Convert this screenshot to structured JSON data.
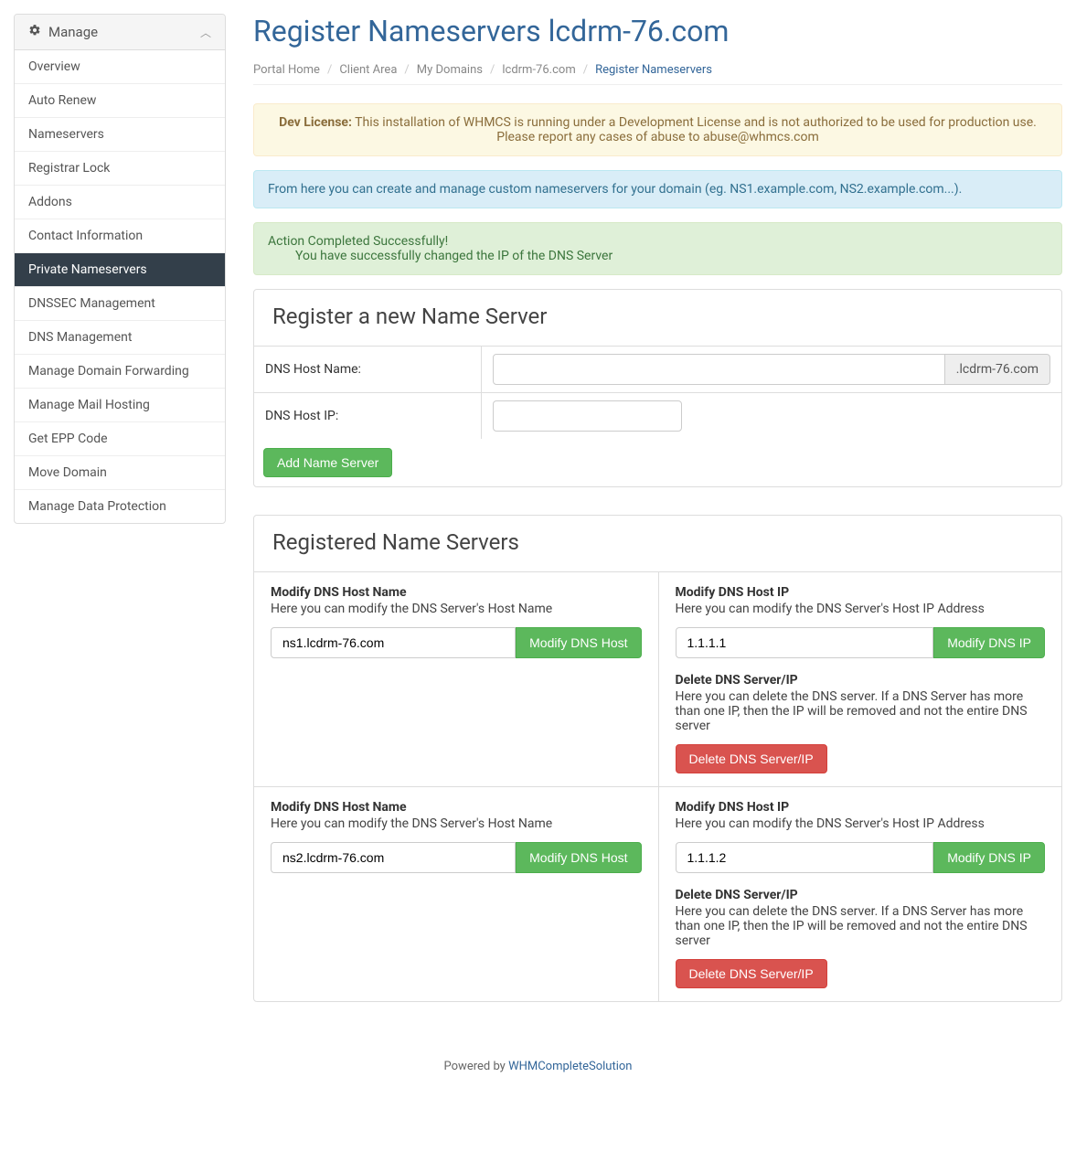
{
  "sidebar": {
    "header": "Manage",
    "items": [
      {
        "label": "Overview",
        "active": false
      },
      {
        "label": "Auto Renew",
        "active": false
      },
      {
        "label": "Nameservers",
        "active": false
      },
      {
        "label": "Registrar Lock",
        "active": false
      },
      {
        "label": "Addons",
        "active": false
      },
      {
        "label": "Contact Information",
        "active": false
      },
      {
        "label": "Private Nameservers",
        "active": true
      },
      {
        "label": "DNSSEC Management",
        "active": false
      },
      {
        "label": "DNS Management",
        "active": false
      },
      {
        "label": "Manage Domain Forwarding",
        "active": false
      },
      {
        "label": "Manage Mail Hosting",
        "active": false
      },
      {
        "label": "Get EPP Code",
        "active": false
      },
      {
        "label": "Move Domain",
        "active": false
      },
      {
        "label": "Manage Data Protection",
        "active": false
      }
    ]
  },
  "page_title": "Register Nameservers lcdrm-76.com",
  "breadcrumb": [
    {
      "label": "Portal Home"
    },
    {
      "label": "Client Area"
    },
    {
      "label": "My Domains"
    },
    {
      "label": "lcdrm-76.com"
    },
    {
      "label": "Register Nameservers",
      "active": true
    }
  ],
  "alerts": {
    "dev_prefix": "Dev License:",
    "dev_text": " This installation of WHMCS is running under a Development License and is not authorized to be used for production use. Please report any cases of abuse to abuse@whmcs.com",
    "info_text": "From here you can create and manage custom nameservers for your domain (eg. NS1.example.com, NS2.example.com...).",
    "success_title": "Action Completed Successfully!",
    "success_body": "You have successfully changed the IP of the DNS Server"
  },
  "register_panel": {
    "title": "Register a new Name Server",
    "hostname_label": "DNS Host Name:",
    "hostip_label": "DNS Host IP:",
    "domain_suffix": ".lcdrm-76.com",
    "add_button": "Add Name Server"
  },
  "registered_panel": {
    "title": "Registered Name Servers",
    "modify_host_title": "Modify DNS Host Name",
    "modify_host_desc": "Here you can modify the DNS Server's Host Name",
    "modify_host_btn": "Modify DNS Host",
    "modify_ip_title": "Modify DNS Host IP",
    "modify_ip_desc": "Here you can modify the DNS Server's Host IP Address",
    "modify_ip_btn": "Modify DNS IP",
    "delete_title": "Delete DNS Server/IP",
    "delete_desc": "Here you can delete the DNS server. If a DNS Server has more than one IP, then the IP will be removed and not the entire DNS server",
    "delete_btn": "Delete DNS Server/IP",
    "servers": [
      {
        "hostname": "ns1.lcdrm-76.com",
        "ip": "1.1.1.1"
      },
      {
        "hostname": "ns2.lcdrm-76.com",
        "ip": "1.1.1.2"
      }
    ]
  },
  "footer": {
    "prefix": "Powered by ",
    "link": "WHMCompleteSolution"
  }
}
